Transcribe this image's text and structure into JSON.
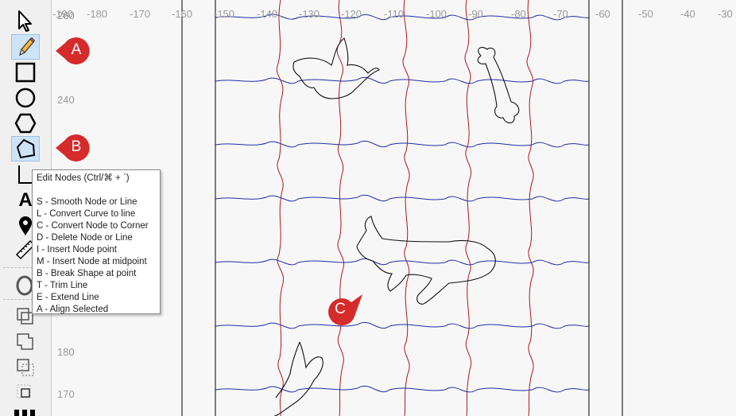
{
  "toolbar": {
    "tools": [
      {
        "name": "select-tool",
        "icon": "arrow-pointer-icon"
      },
      {
        "name": "pencil-tool",
        "icon": "pencil-icon",
        "active": true
      },
      {
        "name": "rectangle-tool",
        "icon": "square-icon"
      },
      {
        "name": "circle-tool",
        "icon": "circle-icon"
      },
      {
        "name": "polygon-tool",
        "icon": "hexagon-icon"
      },
      {
        "name": "edit-nodes-tool",
        "icon": "node-edit-icon",
        "active": true
      },
      {
        "name": "crop-tool",
        "icon": "corner-icon"
      },
      {
        "name": "text-tool",
        "icon": "text-a-icon",
        "label": "A"
      },
      {
        "name": "pin-tool",
        "icon": "map-pin-icon"
      },
      {
        "name": "measure-tool",
        "icon": "ruler-icon"
      }
    ]
  },
  "rulers": {
    "horizontal": [
      "-190",
      "-180",
      "-170",
      "-160",
      "-150",
      "-140",
      "-130",
      "-120",
      "-110",
      "-100",
      "-90",
      "-80",
      "-70",
      "-60",
      "-50",
      "-40",
      "-30"
    ],
    "vertical": [
      "260",
      "240",
      "180",
      "170"
    ]
  },
  "tooltip": {
    "lines": [
      "Edit Nodes (Ctrl/⌘ + `)",
      "",
      "S - Smooth Node or Line",
      "L - Convert Curve to line",
      "C - Convert Node to Corner",
      "D - Delete Node or Line",
      "I - Insert Node point",
      "M - Insert Node at midpoint",
      "B - Break Shape at point",
      "T - Trim Line",
      "E - Extend Line",
      "A - Align Selected"
    ]
  },
  "callouts": [
    {
      "label": "A",
      "color": "#d62b2b"
    },
    {
      "label": "B",
      "color": "#d62b2b"
    },
    {
      "label": "C",
      "color": "#d62b2b"
    }
  ],
  "colors": {
    "horizontal_cut": "#1f2fa6",
    "vertical_cut": "#b01818",
    "shape_outline": "#111111",
    "page_border": "#000000"
  }
}
